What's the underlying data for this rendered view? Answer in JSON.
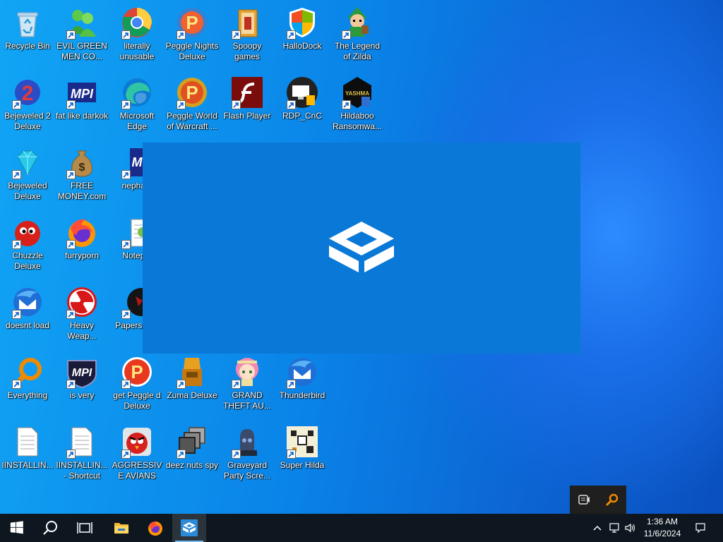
{
  "desktop": {
    "icons": [
      {
        "label": "Recycle Bin",
        "icon": "recycle-bin-icon"
      },
      {
        "label": "EVIL GREEN MEN CO...",
        "icon": "green-men-icon"
      },
      {
        "label": "literally unusable",
        "icon": "chrome-icon"
      },
      {
        "label": "Peggle Nights Deluxe",
        "icon": "peggle-nights-icon"
      },
      {
        "label": "Spoopy games",
        "icon": "folder-icon"
      },
      {
        "label": "HalloDock",
        "icon": "shield-icon"
      },
      {
        "label": "The Legend of Zilda",
        "icon": "zelda-icon"
      },
      {
        "label": "Bejeweled 2 Deluxe",
        "icon": "bejeweled2-icon"
      },
      {
        "label": "fat like darkok",
        "icon": "mpi-icon"
      },
      {
        "label": "Microsoft Edge",
        "icon": "edge-icon"
      },
      {
        "label": "Peggle World of Warcraft ...",
        "icon": "peggle-wow-icon"
      },
      {
        "label": "Flash Player",
        "icon": "flash-icon"
      },
      {
        "label": "RDP_CnC",
        "icon": "rdp-icon"
      },
      {
        "label": "Hildaboo Ransomwa...",
        "icon": "yashma-icon"
      },
      {
        "label": "Bejeweled Deluxe",
        "icon": "diamond-icon"
      },
      {
        "label": "FREE MONEY.com",
        "icon": "money-bag-icon"
      },
      {
        "label": "nepha",
        "icon": "mpi-icon"
      },
      {
        "label": "Chuzzle Deluxe",
        "icon": "chuzzle-icon"
      },
      {
        "label": "furryporn",
        "icon": "firefox-icon"
      },
      {
        "label": "Notepa",
        "icon": "notepad-icon"
      },
      {
        "label": "doesnt load",
        "icon": "thunderbird-icon"
      },
      {
        "label": "Heavy Weap...",
        "icon": "radiation-icon"
      },
      {
        "label": "Papers, P",
        "icon": "papers-icon"
      },
      {
        "label": "Everything",
        "icon": "everything-search-icon"
      },
      {
        "label": "is very",
        "icon": "mpi-shield-icon"
      },
      {
        "label": "get Peggle d Deluxe",
        "icon": "peggle-icon"
      },
      {
        "label": "Zuma Deluxe",
        "icon": "zuma-icon"
      },
      {
        "label": "GRAND THEFT AU...",
        "icon": "anime-girl-icon"
      },
      {
        "label": "Thunderbird",
        "icon": "thunderbird-icon"
      },
      {
        "label": "IINSTALLIN...",
        "icon": "text-file-icon"
      },
      {
        "label": "IINSTALLIN... - Shortcut",
        "icon": "text-file-icon"
      },
      {
        "label": "AGGRESSIVE AVIANS",
        "icon": "angry-bird-icon"
      },
      {
        "label": "deez nuts spy",
        "icon": "stacked-windows-icon"
      },
      {
        "label": "Graveyard Party Scre...",
        "icon": "graveyard-icon"
      },
      {
        "label": "Super Hilda",
        "icon": "pixel-art-icon"
      }
    ]
  },
  "splash": {
    "icon": "sandbox-box-icon",
    "color": "#0a78d6"
  },
  "taskbar": {
    "start": "windows-logo-icon",
    "search": "search-icon",
    "taskview": "task-view-icon",
    "explorer": "file-explorer-icon",
    "firefox": "firefox-icon",
    "sandbox": "sandbox-icon",
    "clock": {
      "time": "1:36 AM",
      "date": "11/6/2024"
    }
  },
  "tray": {
    "popup": [
      "recorder-icon",
      "everything-search-icon"
    ],
    "chevron": "chevron-up-icon",
    "network": "network-icon",
    "volume": "volume-icon",
    "notifications": "notifications-icon"
  }
}
